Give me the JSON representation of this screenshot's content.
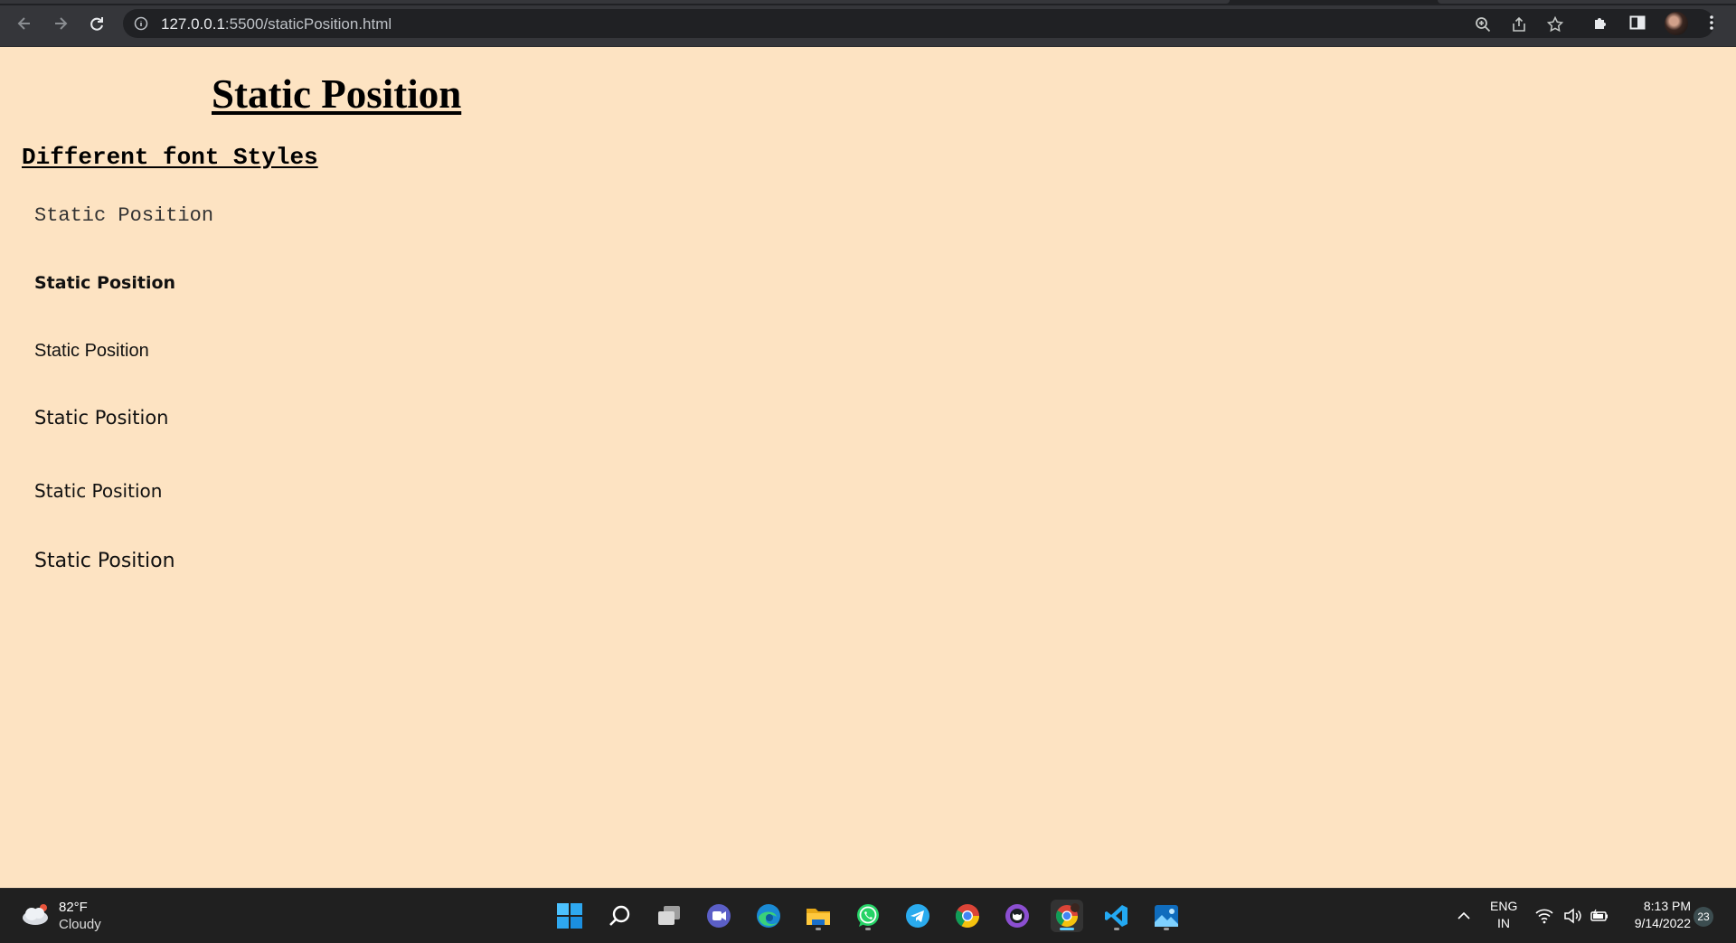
{
  "browser": {
    "url_host": "127.0.0.1",
    "url_rest": ":5500/staticPosition.html",
    "icons": [
      "back-arrow-icon",
      "forward-arrow-icon",
      "reload-icon",
      "site-info-icon",
      "zoom-icon",
      "share-icon",
      "bookmark-star-icon",
      "extensions-puzzle-icon",
      "side-panel-icon",
      "profile-avatar",
      "more-menu-icon"
    ]
  },
  "page": {
    "heading": "Static Position",
    "subheading": "Different font Styles",
    "lines": [
      "Static Position",
      "Static Position",
      "Static Position",
      "Static Position",
      "Static Position",
      "Static Position"
    ],
    "background_color": "#fde3c2"
  },
  "taskbar": {
    "weather": {
      "temp": "82°F",
      "condition": "Cloudy"
    },
    "apps": [
      "start",
      "search",
      "task-view",
      "teams-chat",
      "edge",
      "file-explorer",
      "whatsapp",
      "telegram",
      "chrome",
      "github-desktop",
      "chrome-profile",
      "vscode",
      "photos"
    ],
    "lang_line1": "ENG",
    "lang_line2": "IN",
    "time": "8:13 PM",
    "date": "9/14/2022",
    "notification_count": "23"
  }
}
